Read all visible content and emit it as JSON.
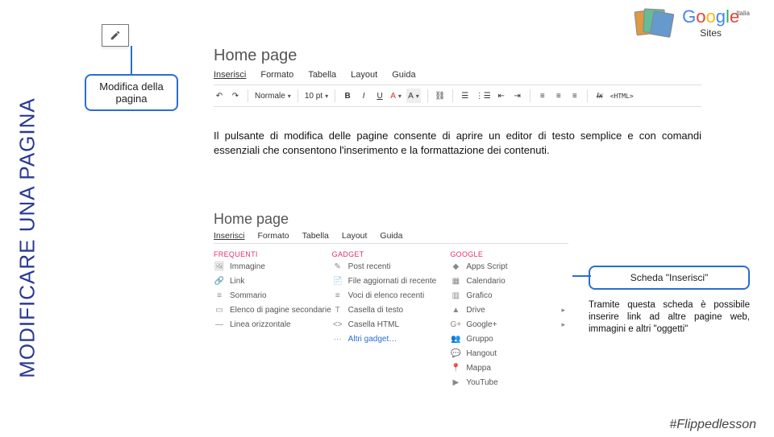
{
  "sidebar_title": "MODIFICARE UNA PAGINA",
  "callout1": {
    "line1": "Modifica della",
    "line2": "pagina"
  },
  "top_right": {
    "brand": "Google",
    "sub": "Sites",
    "suffix": "Italia"
  },
  "section1": {
    "title": "Home page",
    "menu": [
      "Inserisci",
      "Formato",
      "Tabella",
      "Layout",
      "Guida"
    ],
    "toolbar": {
      "style": "Normale",
      "font_size": "10 pt",
      "bold": "B",
      "italic": "I",
      "underline": "U",
      "color_a": "A",
      "color_b": "A",
      "link": "⊕",
      "ol": "≡",
      "ul": "≣",
      "indent_out": "⇤",
      "indent_in": "⇥",
      "align_l": "≡",
      "align_c": "≡",
      "align_r": "≡",
      "clear": "Ix",
      "html": "<HTML>"
    }
  },
  "body1": "Il pulsante di modifica delle pagine consente di aprire un editor di testo semplice e con comandi essenziali che consentono l'inserimento e la formattazione dei contenuti.",
  "section2": {
    "title": "Home page",
    "menu": [
      "Inserisci",
      "Formato",
      "Tabella",
      "Layout",
      "Guida"
    ],
    "col_heads": [
      "FREQUENTI",
      "GADGET",
      "GOOGLE"
    ],
    "col1": [
      {
        "icon": "🖼",
        "label": "Immagine"
      },
      {
        "icon": "🔗",
        "label": "Link"
      },
      {
        "icon": "≡",
        "label": "Sommario"
      },
      {
        "icon": "▭",
        "label": "Elenco di pagine secondarie"
      },
      {
        "icon": "—",
        "label": "Linea orizzontale"
      }
    ],
    "col2": [
      {
        "icon": "✎",
        "label": "Post recenti"
      },
      {
        "icon": "📄",
        "label": "File aggiornati di recente"
      },
      {
        "icon": "≡",
        "label": "Voci di elenco recenti"
      },
      {
        "icon": "T",
        "label": "Casella di testo"
      },
      {
        "icon": "<>",
        "label": "Casella HTML"
      },
      {
        "icon": "···",
        "label": "Altri gadget…",
        "altri": true
      }
    ],
    "col3": [
      {
        "icon": "◆",
        "label": "Apps Script"
      },
      {
        "icon": "▦",
        "label": "Calendario"
      },
      {
        "icon": "▥",
        "label": "Grafico"
      },
      {
        "icon": "▲",
        "label": "Drive",
        "arrow": true
      },
      {
        "icon": "G+",
        "label": "Google+",
        "arrow": true
      },
      {
        "icon": "👥",
        "label": "Gruppo"
      },
      {
        "icon": "💬",
        "label": "Hangout"
      },
      {
        "icon": "📍",
        "label": "Mappa"
      },
      {
        "icon": "▶",
        "label": "YouTube"
      }
    ]
  },
  "callout2": {
    "title": "Scheda \"Inserisci\"",
    "text": "Tramite questa scheda è possibile inserire link ad altre pagine web, immagini e altri \"oggetti\""
  },
  "footer": "#Flippedlesson"
}
